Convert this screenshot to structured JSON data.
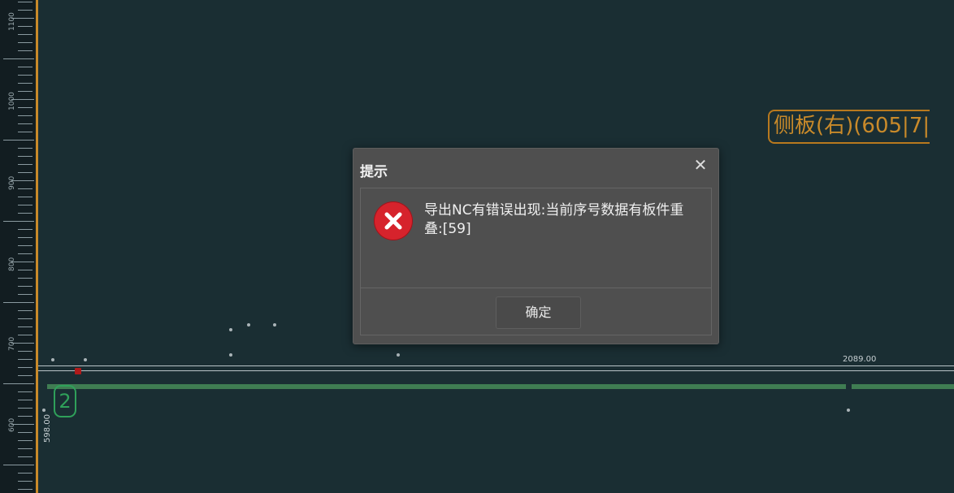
{
  "ruler": {
    "labels": [
      "1100",
      "1000",
      "900",
      "800",
      "700",
      "600"
    ]
  },
  "canvas": {
    "panel_label": "侧板(右)(605|7|",
    "badge": "2",
    "dim_right": "2089.00",
    "dim_left": "598.00"
  },
  "dialog": {
    "title": "提示",
    "close_icon": "close-icon",
    "icon": "error-icon",
    "message": "导出NC有错误出现:当前序号数据有板件重叠:[59]",
    "ok_label": "确定"
  },
  "colors": {
    "background": "#1a2e33",
    "ruler_accent": "#c98a2a",
    "panel_label": "#c98a2a",
    "badge": "#2fa05a",
    "error": "#d6232c",
    "dialog_bg": "#4f4f4f"
  }
}
